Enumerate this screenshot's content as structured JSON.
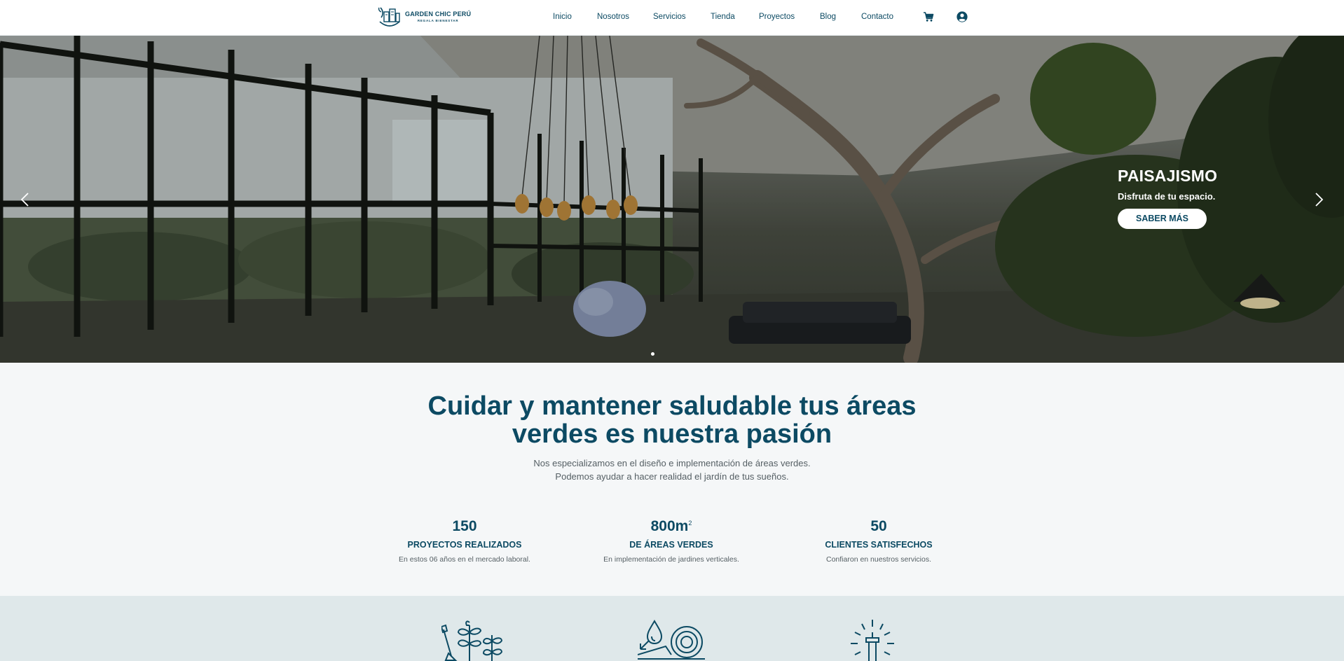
{
  "brand": {
    "name": "GARDEN CHIC PERÚ",
    "tagline": "REGALA BIENESTAR",
    "color": "#0c4a63"
  },
  "nav": {
    "items": [
      "Inicio",
      "Nosotros",
      "Servicios",
      "Tienda",
      "Proyectos",
      "Blog",
      "Contacto"
    ],
    "cart_icon": "cart-icon",
    "account_icon": "account-icon"
  },
  "hero": {
    "title": "PAISAJISMO",
    "subtitle": "Disfruta de tu espacio.",
    "button": "SABER MÁS",
    "prev_icon": "chevron-left-icon",
    "next_icon": "chevron-right-icon"
  },
  "intro": {
    "title_line1": "Cuidar y mantener saludable tus áreas",
    "title_line2": "verdes es nuestra pasión",
    "text_line1": "Nos especializamos en el diseño e implementación de áreas verdes.",
    "text_line2": "Podemos ayudar a hacer realidad el jardín de tus sueños."
  },
  "stats": [
    {
      "value": "150",
      "sup": "",
      "label": "PROYECTOS REALIZADOS",
      "desc": "En estos 06 años en el mercado laboral."
    },
    {
      "value": "800m",
      "sup": "2",
      "label": "DE ÁREAS VERDES",
      "desc": "En implementación de jardines verticales."
    },
    {
      "value": "50",
      "sup": "",
      "label": "CLIENTES SATISFECHOS",
      "desc": "Confiaron en nuestros servicios."
    }
  ],
  "services": {
    "icons": [
      "gardening-icon",
      "irrigation-hose-icon",
      "sprinkler-icon"
    ]
  }
}
